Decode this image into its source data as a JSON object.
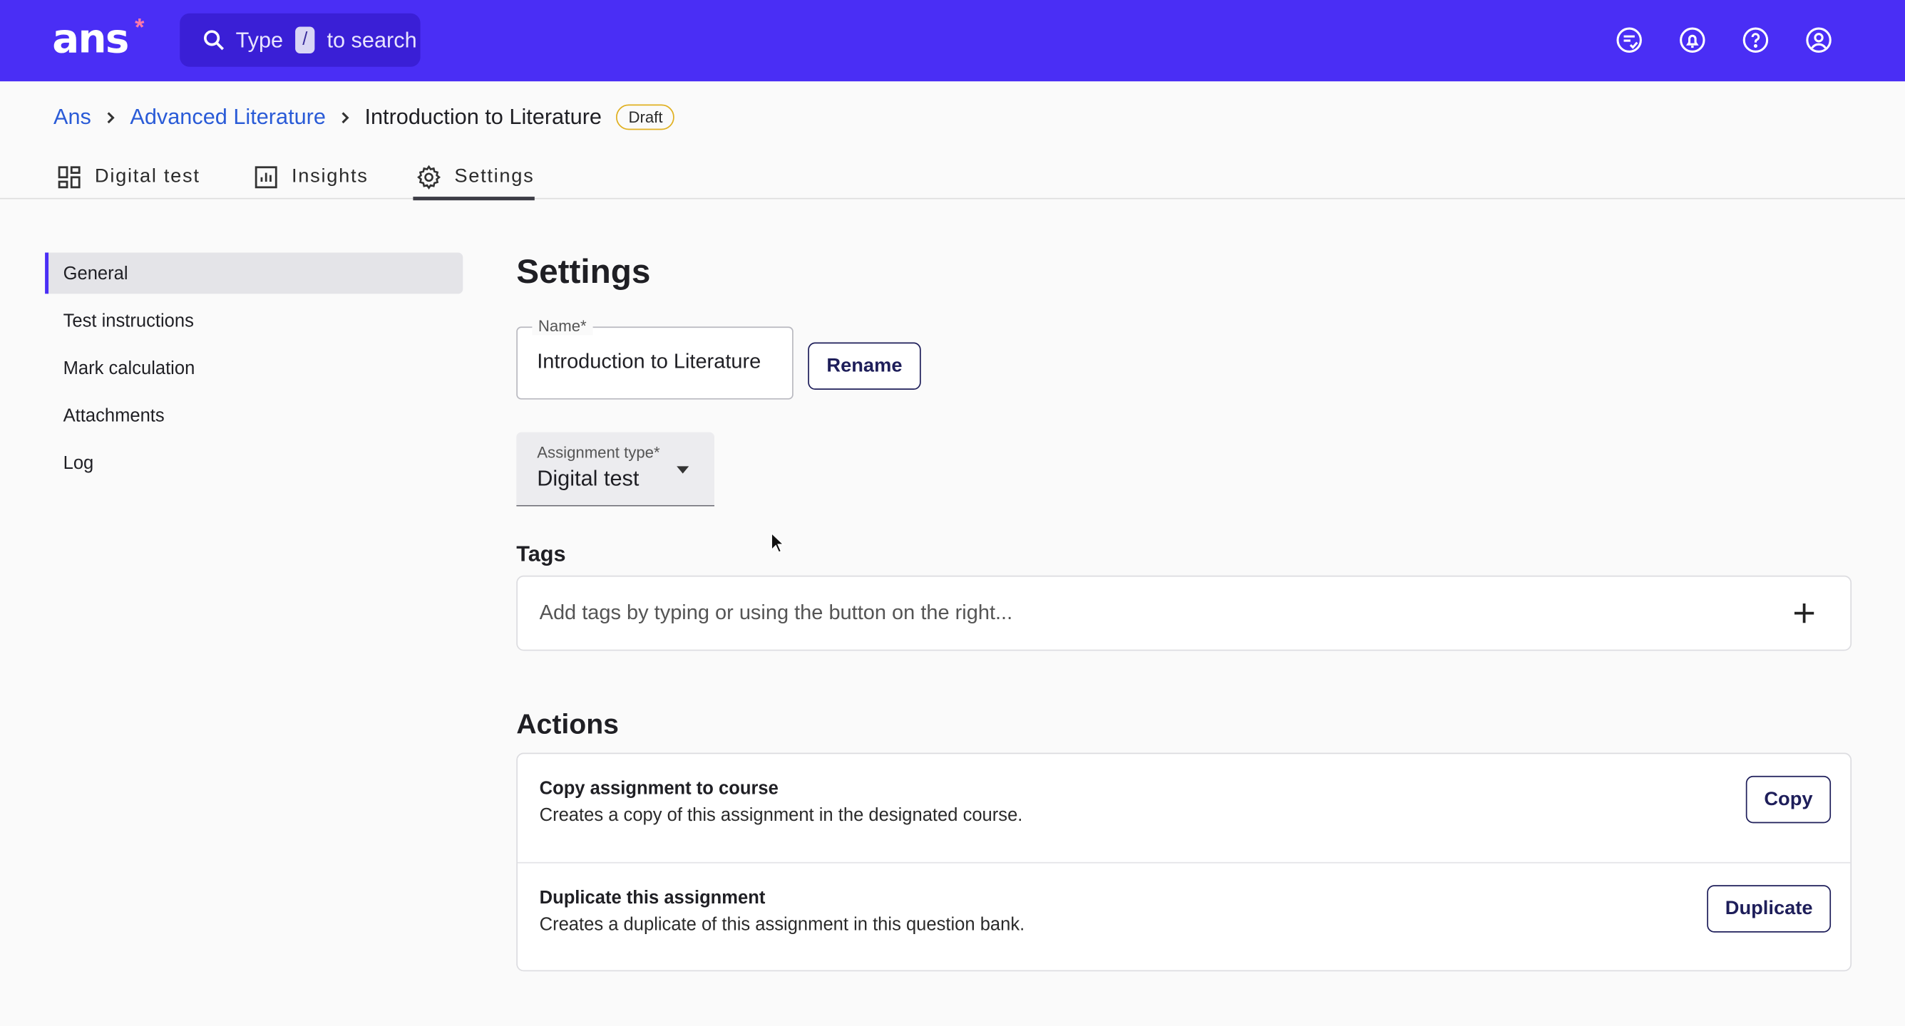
{
  "header": {
    "logo": "ans",
    "logo_mark": "*",
    "search": {
      "prefix": "Type",
      "key": "/",
      "suffix": "to search"
    },
    "icons": [
      "feedback-icon",
      "bell-icon",
      "help-icon",
      "account-icon"
    ]
  },
  "breadcrumb": {
    "items": [
      "Ans",
      "Advanced Literature",
      "Introduction to Literature"
    ],
    "badge": "Draft"
  },
  "tabs": [
    {
      "label": "Digital test",
      "icon": "grid-icon"
    },
    {
      "label": "Insights",
      "icon": "chart-icon"
    },
    {
      "label": "Settings",
      "icon": "gear-icon",
      "active": true
    }
  ],
  "sidebar": {
    "items": [
      {
        "label": "General",
        "active": true
      },
      {
        "label": "Test instructions"
      },
      {
        "label": "Mark calculation"
      },
      {
        "label": "Attachments"
      },
      {
        "label": "Log"
      }
    ]
  },
  "main": {
    "title": "Settings",
    "name_field": {
      "label": "Name*",
      "value": "Introduction to Literature"
    },
    "rename_label": "Rename",
    "assignment_type": {
      "label": "Assignment type*",
      "value": "Digital test"
    },
    "tags": {
      "heading": "Tags",
      "placeholder": "Add tags by typing or using the button on the right..."
    },
    "actions": {
      "heading": "Actions",
      "items": [
        {
          "title": "Copy assignment to course",
          "description": "Creates a copy of this assignment in the designated course.",
          "button": "Copy"
        },
        {
          "title": "Duplicate this assignment",
          "description": "Creates a duplicate of this assignment in this question bank.",
          "button": "Duplicate"
        }
      ]
    }
  },
  "colors": {
    "brand": "#4a2ef5",
    "badge_border": "#e0b020",
    "link": "#2a5bd7"
  }
}
